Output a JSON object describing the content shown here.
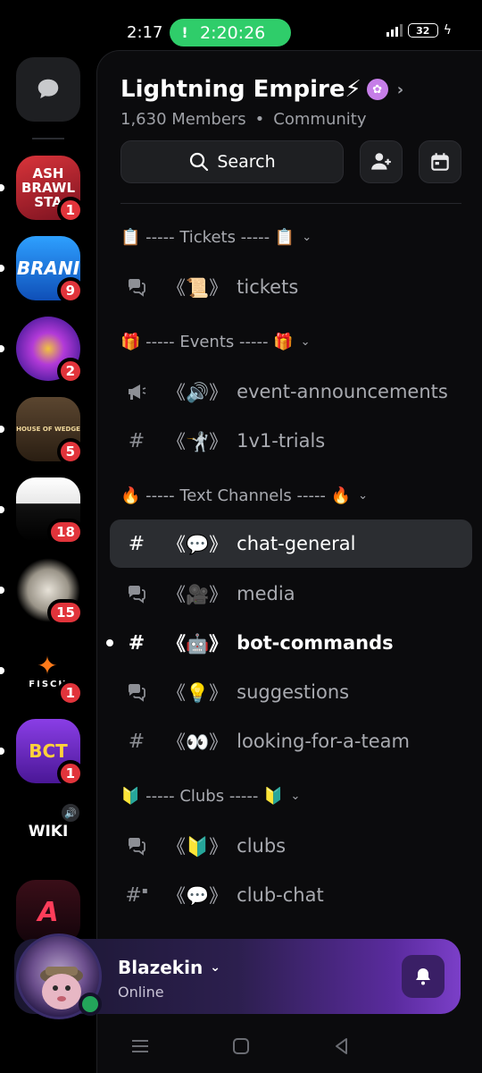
{
  "status": {
    "time": "2:17",
    "call_timer": "2:20:26",
    "battery": "32"
  },
  "rail": {
    "servers": [
      {
        "label": "ASH BRAWL STA",
        "badge": "1",
        "color": "#b8282c"
      },
      {
        "label": "BRANI",
        "badge": "9",
        "color": "#1c6fd6"
      },
      {
        "label": "",
        "badge": "2",
        "color": "#6a2bd1"
      },
      {
        "label": "HOUSE OF WEDGE",
        "badge": "5",
        "color": "#3b2a1a"
      },
      {
        "label": "",
        "badge": "18",
        "color": "#111111"
      },
      {
        "label": "",
        "badge": "15",
        "color": "#2a2a33"
      },
      {
        "label": "FISCH",
        "badge": "1",
        "color": "#000000"
      },
      {
        "label": "BCT",
        "badge": "1",
        "color": "#6d2fd2"
      },
      {
        "label": "WIKI",
        "badge": "",
        "color": "#000000"
      },
      {
        "label": "A",
        "badge": "",
        "color": "#2a0a0f"
      }
    ]
  },
  "server": {
    "name": "Lightning Empire⚡",
    "members": "1,630 Members",
    "type": "Community"
  },
  "search": {
    "label": "Search"
  },
  "categories": [
    {
      "label": "📋 ----- Tickets ----- 📋"
    },
    {
      "label": "🎁 ----- Events ----- 🎁"
    },
    {
      "label": "🔥 ----- Text Channels ----- 🔥"
    },
    {
      "label": "🔰 ----- Clubs ----- 🔰"
    }
  ],
  "channels": {
    "tickets": {
      "emoji": "《📜》",
      "name": "tickets"
    },
    "event_announcements": {
      "emoji": "《🔊》",
      "name": "event-announcements"
    },
    "trials": {
      "emoji": "《🤺》",
      "name": "1v1-trials"
    },
    "chat_general": {
      "emoji": "《💬》",
      "name": "chat-general"
    },
    "media": {
      "emoji": "《🎥》",
      "name": "media"
    },
    "bot_commands": {
      "emoji": "《🤖》",
      "name": "bot-commands"
    },
    "suggestions": {
      "emoji": "《💡》",
      "name": "suggestions"
    },
    "looking_for_team": {
      "emoji": "《👀》",
      "name": "looking-for-a-team"
    },
    "clubs": {
      "emoji": "《🔰》",
      "name": "clubs"
    },
    "club_chat": {
      "emoji": "《💬》",
      "name": "club-chat"
    }
  },
  "user": {
    "name": "Blazekin",
    "status": "Online"
  },
  "colors": {
    "accent_green": "#2fcd6a",
    "badge_red": "#e1343b",
    "online_green": "#23a55a",
    "active_row": "#2b2d31"
  }
}
